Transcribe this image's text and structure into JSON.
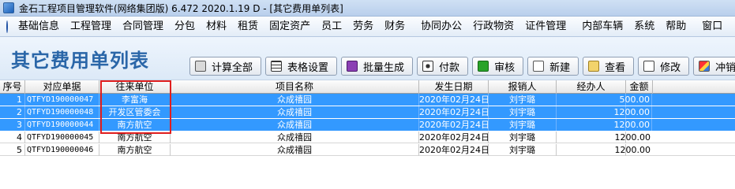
{
  "window": {
    "title": "金石工程项目管理软件(网络集团版) 6.472  2020.1.19 D - [其它费用单列表]"
  },
  "menu": {
    "items": [
      "基础信息",
      "工程管理",
      "合同管理",
      "分包",
      "材料",
      "租赁",
      "固定资产",
      "员工",
      "劳务",
      "财务",
      "协同办公",
      "行政物资",
      "证件管理",
      "内部车辆",
      "系统",
      "帮助",
      "窗口",
      "窗"
    ]
  },
  "page": {
    "title": "其它费用单列表"
  },
  "toolbar": {
    "calc_all": "计算全部",
    "table_settings": "表格设置",
    "batch_generate": "批量生成",
    "pay": "付款",
    "audit": "审核",
    "new": "新建",
    "view": "查看",
    "edit": "修改",
    "cancel": "冲销"
  },
  "table": {
    "headers": {
      "idx": "序号",
      "doc": "对应单据",
      "party": "往来单位",
      "project": "项目名称",
      "date": "发生日期",
      "reporter": "报销人",
      "agent": "经办人",
      "amount": "金额"
    },
    "rows": [
      {
        "idx": "1",
        "doc": "QTFYD190000047",
        "party": "李富海",
        "project": "众成禧园",
        "date": "2020年02月24日",
        "reporter": "刘宇璐",
        "agent": "",
        "amount": "500.00",
        "selected": true
      },
      {
        "idx": "2",
        "doc": "QTFYD190000048",
        "party": "开发区管委会",
        "project": "众成禧园",
        "date": "2020年02月24日",
        "reporter": "刘宇璐",
        "agent": "",
        "amount": "1200.00",
        "selected": true
      },
      {
        "idx": "3",
        "doc": "QTFYD190000044",
        "party": "南方航空",
        "project": "众成禧园",
        "date": "2020年02月24日",
        "reporter": "刘宇璐",
        "agent": "",
        "amount": "1200.00",
        "selected": true
      },
      {
        "idx": "4",
        "doc": "QTFYD190000045",
        "party": "南方航空",
        "project": "众成禧园",
        "date": "2020年02月24日",
        "reporter": "刘宇璐",
        "agent": "",
        "amount": "1200.00",
        "selected": false
      },
      {
        "idx": "5",
        "doc": "QTFYD190000046",
        "party": "南方航空",
        "project": "众成禧园",
        "date": "2020年02月24日",
        "reporter": "刘宇璐",
        "agent": "",
        "amount": "1200.00",
        "selected": false
      }
    ]
  }
}
